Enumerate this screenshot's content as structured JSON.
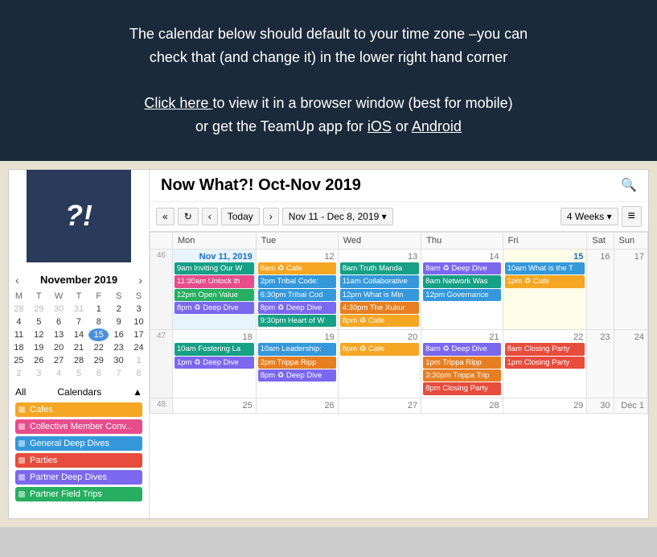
{
  "banner": {
    "line1": "The calendar below should default to your time zone –you can",
    "line2": "check that (and change it) in the lower right hand corner",
    "line3_before": "to view it in a browser window (best for mobile)",
    "clickhere": "Click here",
    "line4": "or get the TeamUp app for ",
    "ios": "iOS",
    "or": " or ",
    "android": "Android"
  },
  "calendar": {
    "title": "Now What?! Oct-Nov 2019",
    "month": "November",
    "year": "2019",
    "toolbar": {
      "prev_prev": "«",
      "refresh": "↻",
      "prev": "‹",
      "today": "Today",
      "next": "›",
      "date_range": "Nov 11 - Dec 8, 2019",
      "view": "4 Weeks",
      "menu": "≡"
    },
    "columns": [
      "",
      "Mon",
      "Tue",
      "Wed",
      "Thu",
      "Fri",
      "Sat",
      "Sun"
    ],
    "mini_month": {
      "days_header": [
        "M",
        "T",
        "W",
        "T",
        "F",
        "S",
        "S"
      ],
      "weeks": [
        [
          "28",
          "29",
          "30",
          "31",
          "1",
          "2",
          "3"
        ],
        [
          "4",
          "5",
          "6",
          "7",
          "8",
          "9",
          "10"
        ],
        [
          "11",
          "12",
          "13",
          "14",
          "15",
          "16",
          "17"
        ],
        [
          "18",
          "19",
          "20",
          "21",
          "22",
          "23",
          "24"
        ],
        [
          "25",
          "26",
          "27",
          "28",
          "29",
          "30",
          "1"
        ],
        [
          "2",
          "3",
          "4",
          "5",
          "6",
          "7",
          "8"
        ]
      ],
      "today": "15"
    },
    "calendars_label": "Calendars",
    "all_label": "All",
    "calendar_items": [
      {
        "name": "Cafes",
        "color": "#f5a623"
      },
      {
        "name": "Collective Member Conv...",
        "color": "#e74c8b"
      },
      {
        "name": "General Deep Dives",
        "color": "#3498db"
      },
      {
        "name": "Parties",
        "color": "#e74c3c"
      },
      {
        "name": "Partner Deep Dives",
        "color": "#7b68ee"
      },
      {
        "name": "Partner Field Trips",
        "color": "#27ae60"
      }
    ],
    "rows": [
      {
        "week_num": "46",
        "days": [
          {
            "date": "Nov 11, 2019",
            "date_display": "Nov 11, 2019",
            "is_current": true,
            "events": [
              {
                "time": "9am",
                "title": "Inviting Our W",
                "color": "ev-teal"
              },
              {
                "time": "11:30am",
                "title": "Unlock th",
                "color": "ev-collective"
              },
              {
                "time": "12pm",
                "title": "Open Value",
                "color": "ev-green"
              },
              {
                "time": "8pm",
                "title": "♻ Deep Dive",
                "color": "ev-depdive"
              }
            ]
          },
          {
            "date": "12",
            "events": [
              {
                "time": "8am",
                "title": "♻ Cafe",
                "color": "ev-cafe"
              },
              {
                "time": "2pm",
                "title": "Tribal Code:",
                "color": "ev-general"
              },
              {
                "time": "6:30pm",
                "title": "Tribal Cod",
                "color": "ev-general"
              },
              {
                "time": "8pm",
                "title": "♻ Deep Dive",
                "color": "ev-depdive"
              },
              {
                "time": "9:30pm",
                "title": "Heart of W",
                "color": "ev-teal"
              }
            ]
          },
          {
            "date": "13",
            "events": [
              {
                "time": "8am",
                "title": "Truth Manda",
                "color": "ev-teal"
              },
              {
                "time": "11am",
                "title": "Collaborative",
                "color": "ev-general"
              },
              {
                "time": "12pm",
                "title": "What is Min",
                "color": "ev-general"
              },
              {
                "time": "4:30pm",
                "title": "The Xukur",
                "color": "ev-orange"
              },
              {
                "time": "8pm",
                "title": "♻ Cafe",
                "color": "ev-cafe"
              }
            ]
          },
          {
            "date": "14",
            "events": [
              {
                "time": "8am",
                "title": "♻ Deep Dive",
                "color": "ev-depdive"
              },
              {
                "time": "8am",
                "title": "Network Was",
                "color": "ev-teal"
              },
              {
                "time": "12pm",
                "title": "Governance",
                "color": "ev-general"
              }
            ]
          },
          {
            "date": "15",
            "is_today": true,
            "events": [
              {
                "time": "10am",
                "title": "What is the T",
                "color": "ev-general"
              },
              {
                "time": "1pm",
                "title": "♻ Cafe",
                "color": "ev-cafe"
              }
            ]
          },
          {
            "date": "16",
            "events": []
          },
          {
            "date": "17",
            "events": []
          }
        ]
      },
      {
        "week_num": "47",
        "days": [
          {
            "date": "18",
            "events": [
              {
                "time": "10am",
                "title": "Fostering La",
                "color": "ev-teal"
              },
              {
                "time": "1pm",
                "title": "♻ Deep Dive",
                "color": "ev-depdive"
              }
            ]
          },
          {
            "date": "19",
            "events": [
              {
                "time": "10am",
                "title": "Leadership:",
                "color": "ev-general"
              },
              {
                "time": "2pm",
                "title": "Trippa Ripp",
                "color": "ev-orange"
              },
              {
                "time": "8pm",
                "title": "♻ Deep Dive",
                "color": "ev-depdive"
              }
            ]
          },
          {
            "date": "20",
            "events": [
              {
                "time": "8pm",
                "title": "♻ Cafe",
                "color": "ev-cafe"
              }
            ]
          },
          {
            "date": "21",
            "events": [
              {
                "time": "8am",
                "title": "♻ Deep Dive",
                "color": "ev-depdive"
              },
              {
                "time": "1pm",
                "title": "Trippa Ripp",
                "color": "ev-orange"
              },
              {
                "time": "3:30pm",
                "title": "Trippa Trip",
                "color": "ev-orange"
              },
              {
                "time": "8pm",
                "title": "Closing Party",
                "color": "ev-party"
              }
            ]
          },
          {
            "date": "22",
            "events": [
              {
                "time": "8am",
                "title": "Closing Party",
                "color": "ev-party"
              },
              {
                "time": "1pm",
                "title": "Closing Party",
                "color": "ev-party"
              }
            ]
          },
          {
            "date": "23",
            "events": []
          },
          {
            "date": "24",
            "events": []
          }
        ]
      },
      {
        "week_num": "48",
        "days": [
          {
            "date": "25",
            "events": []
          },
          {
            "date": "26",
            "events": []
          },
          {
            "date": "27",
            "events": []
          },
          {
            "date": "28",
            "events": []
          },
          {
            "date": "29",
            "events": []
          },
          {
            "date": "30",
            "events": []
          },
          {
            "date": "Dec 1",
            "events": []
          }
        ]
      }
    ]
  }
}
